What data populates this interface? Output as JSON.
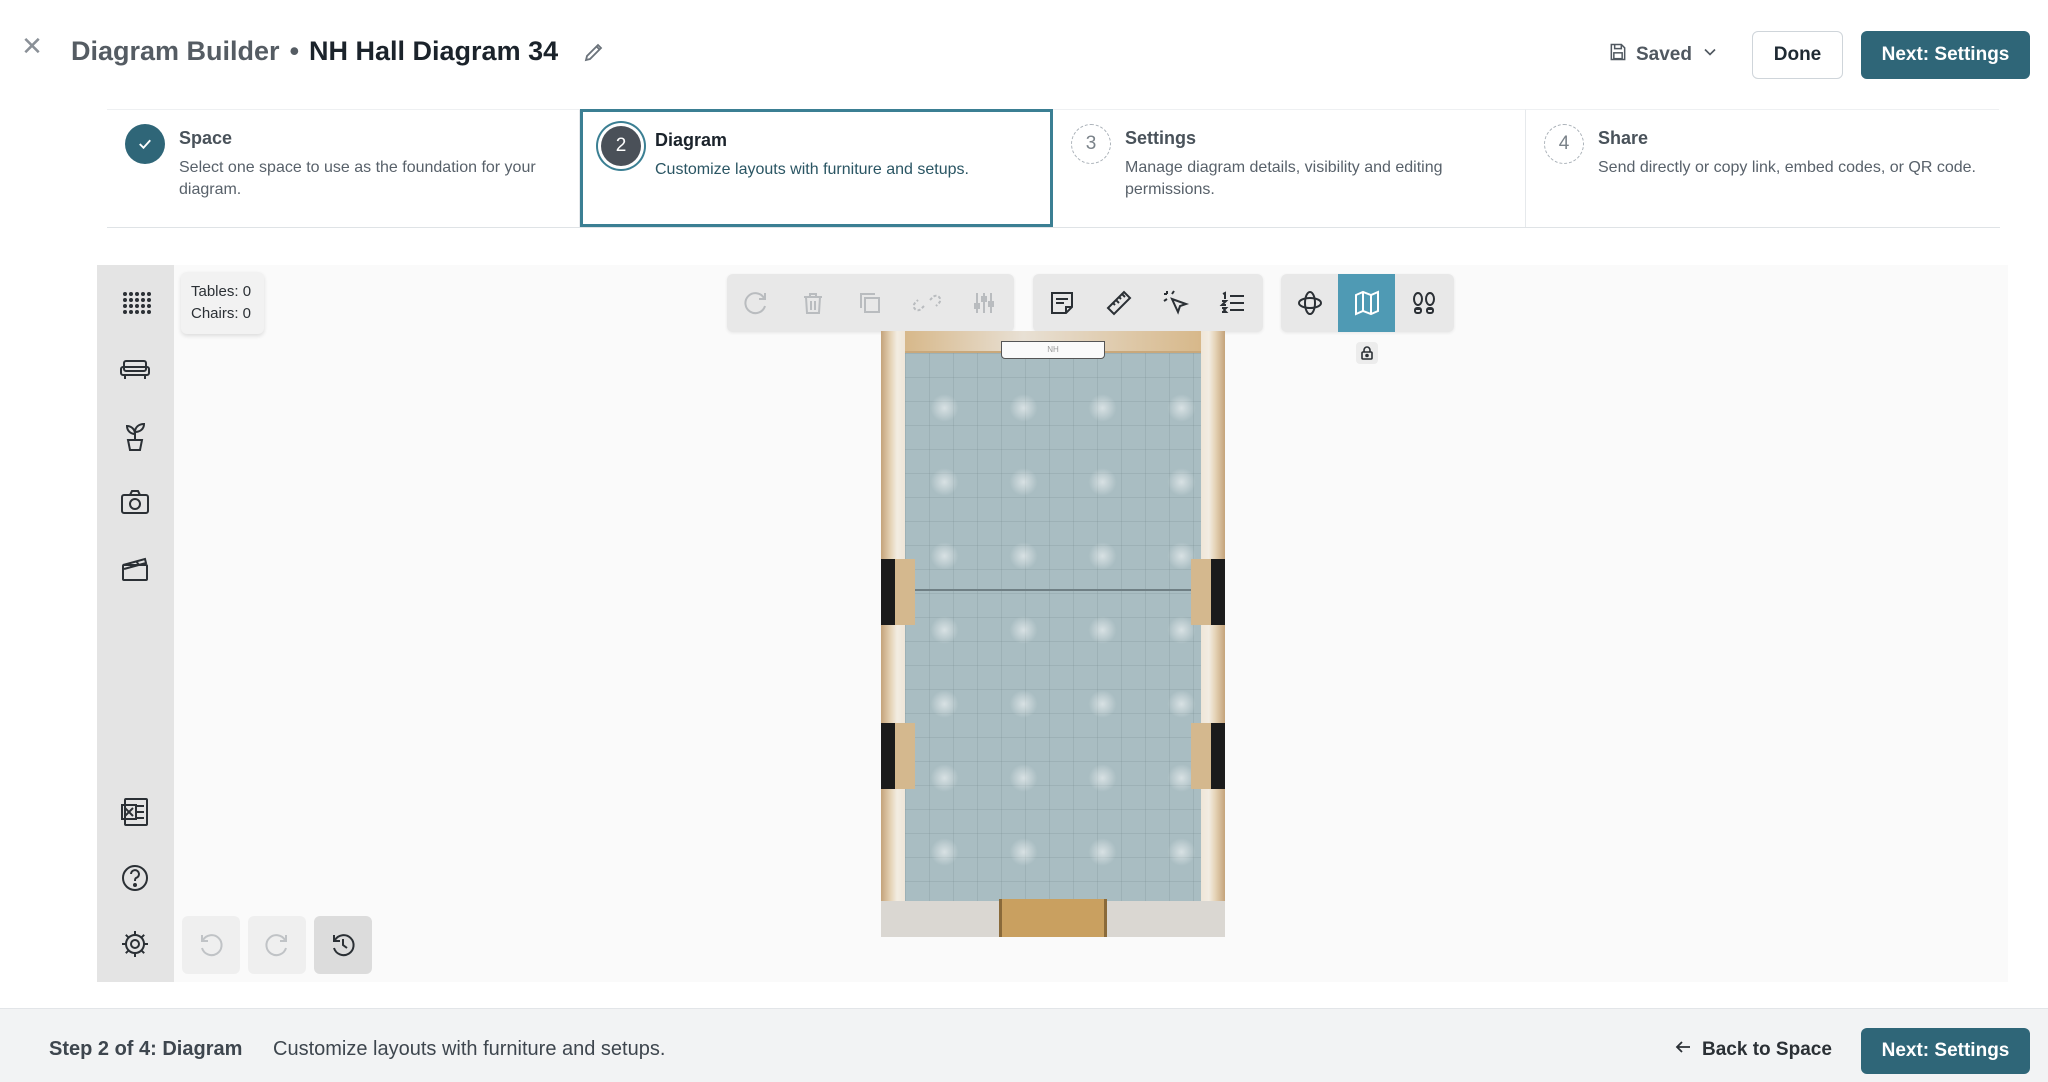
{
  "header": {
    "app_name": "Diagram Builder",
    "separator": "•",
    "diagram_name": "NH Hall Diagram 34",
    "save_status": "Saved",
    "done_label": "Done",
    "next_label": "Next: Settings"
  },
  "steps": [
    {
      "number": "1",
      "title": "Space",
      "description": "Select one space to use as the foundation for your diagram.",
      "state": "done"
    },
    {
      "number": "2",
      "title": "Diagram",
      "description": "Customize layouts with furniture and setups.",
      "state": "current"
    },
    {
      "number": "3",
      "title": "Settings",
      "description": "Manage diagram details, visibility and editing permissions.",
      "state": "todo"
    },
    {
      "number": "4",
      "title": "Share",
      "description": "Send directly or copy link, embed codes, or QR code.",
      "state": "todo"
    }
  ],
  "counts": {
    "tables": "Tables: 0",
    "chairs": "Chairs: 0"
  },
  "left_rail_icons": [
    "tables-grid-icon",
    "sofa-icon",
    "plant-icon",
    "camera-icon",
    "clapperboard-icon",
    "excel-export-icon",
    "help-icon",
    "settings-icon"
  ],
  "toolbar_edit_icons": [
    "redo-icon",
    "delete-icon",
    "duplicate-icon",
    "unlink-icon",
    "adjust-icon"
  ],
  "toolbar_tool_icons": [
    "note-icon",
    "ruler-icon",
    "select-icon",
    "numbered-list-icon"
  ],
  "toolbar_view_icons": [
    "rotate-3d-icon",
    "map-view-icon",
    "footprints-icon"
  ],
  "active_view": "map-view-icon",
  "floor_plan": {
    "stage_label": "NH"
  },
  "footer": {
    "step_label": "Step 2 of 4: Diagram",
    "step_description": "Customize layouts with furniture and setups.",
    "back_label": "Back to Space",
    "next_label": "Next: Settings"
  },
  "colors": {
    "primary": "#2f6678",
    "active_tool": "#4f9ab4",
    "active_step_border": "#3b7f93"
  }
}
